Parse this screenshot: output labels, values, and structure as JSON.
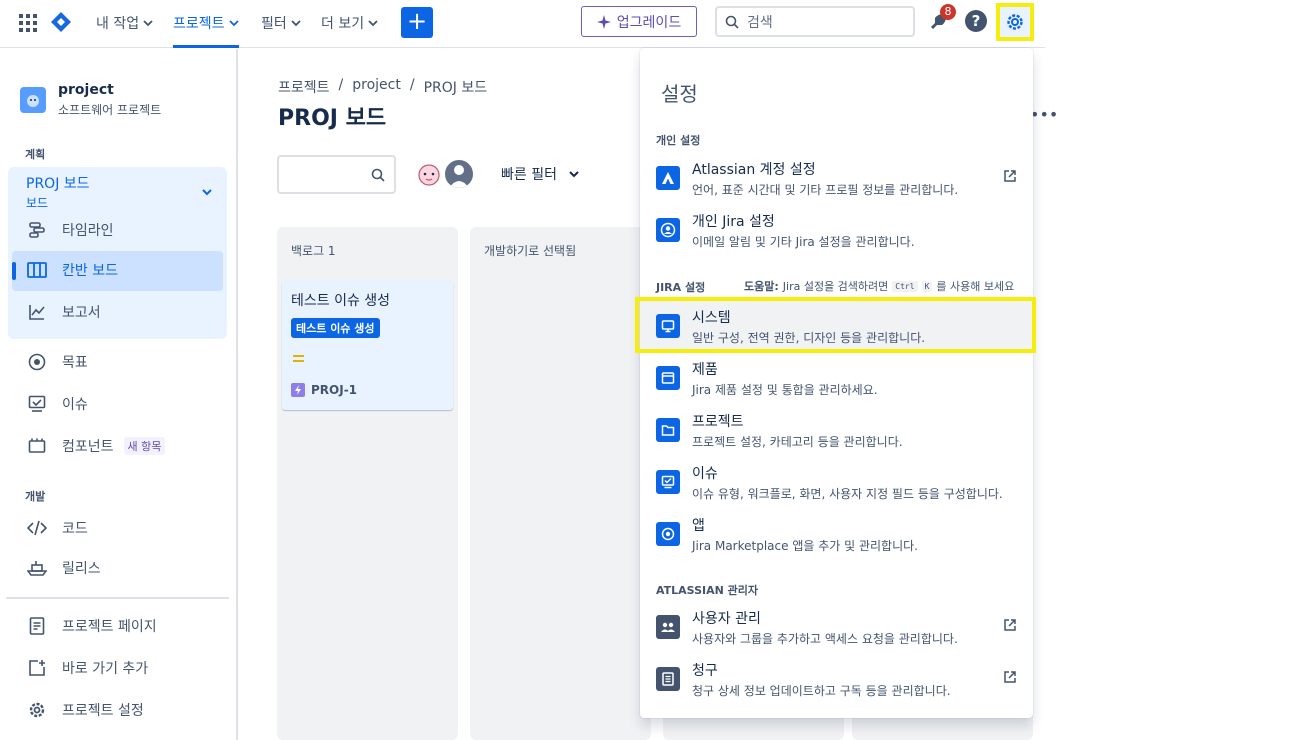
{
  "topnav": {
    "my_work": "내 작업",
    "projects": "프로젝트",
    "filters": "필터",
    "more": "더 보기",
    "create": "+",
    "upgrade": "업그레이드",
    "search_placeholder": "검색",
    "notification_count": "8",
    "help": "?"
  },
  "sidebar": {
    "project_name": "project",
    "project_type": "소프트웨어 프로젝트",
    "section_plan": "계획",
    "board_selector": "PROJ 보드",
    "board_selector_sub": "보드",
    "timeline": "타임라인",
    "kanban": "칸반 보드",
    "reports": "보고서",
    "goals": "목표",
    "issues": "이슈",
    "components": "컴포넌트",
    "new_tag": "새 항목",
    "section_dev": "개발",
    "code": "코드",
    "releases": "릴리스",
    "project_pages": "프로젝트 페이지",
    "add_shortcut": "바로 가기 추가",
    "project_settings": "프로젝트 설정"
  },
  "main": {
    "breadcrumb": [
      "프로젝트",
      "/",
      "project",
      "/",
      "PROJ 보드"
    ],
    "title": "PROJ 보드",
    "quick_filter": "빠른 필터",
    "columns": [
      "백로그 1",
      "개발하기로 선택됨"
    ],
    "card": {
      "title": "테스트 이슈 생성",
      "tag": "테스트 이슈 생성",
      "key": "PROJ-1"
    }
  },
  "settings_menu": {
    "title": "설정",
    "personal_section": "개인 설정",
    "jira_section": "JIRA 설정",
    "help_prefix": "도움말:",
    "help_text_1": "Jira 설정을 검색하려면",
    "kbd_ctrl": "Ctrl",
    "kbd_k": "K",
    "help_text_2": "를 사용해 보세요",
    "admin_section": "ATLASSIAN 관리자",
    "items": [
      {
        "title": "Atlassian 계정 설정",
        "desc": "언어, 표준 시간대 및 기타 프로필 정보를 관리합니다."
      },
      {
        "title": "개인 Jira 설정",
        "desc": "이메일 알림 및 기타 Jira 설정을 관리합니다."
      },
      {
        "title": "시스템",
        "desc": "일반 구성, 전역 권한, 디자인 등을 관리합니다."
      },
      {
        "title": "제품",
        "desc": "Jira 제품 설정 및 통합을 관리하세요."
      },
      {
        "title": "프로젝트",
        "desc": "프로젝트 설정, 카테고리 등을 관리합니다."
      },
      {
        "title": "이슈",
        "desc": "이슈 유형, 워크플로, 화면, 사용자 지정 필드 등을 구성합니다."
      },
      {
        "title": "앱",
        "desc": "Jira Marketplace 앱을 추가 및 관리합니다."
      },
      {
        "title": "사용자 관리",
        "desc": "사용자와 그룹을 추가하고 액세스 요청을 관리합니다."
      },
      {
        "title": "청구",
        "desc": "청구 상세 정보 업데이트하고 구독 등을 관리합니다."
      }
    ]
  },
  "colors": {
    "accent": "#0c66e4",
    "highlight": "#f5ed0c",
    "upgrade": "#5e4db2",
    "badge": "#c9372c"
  }
}
